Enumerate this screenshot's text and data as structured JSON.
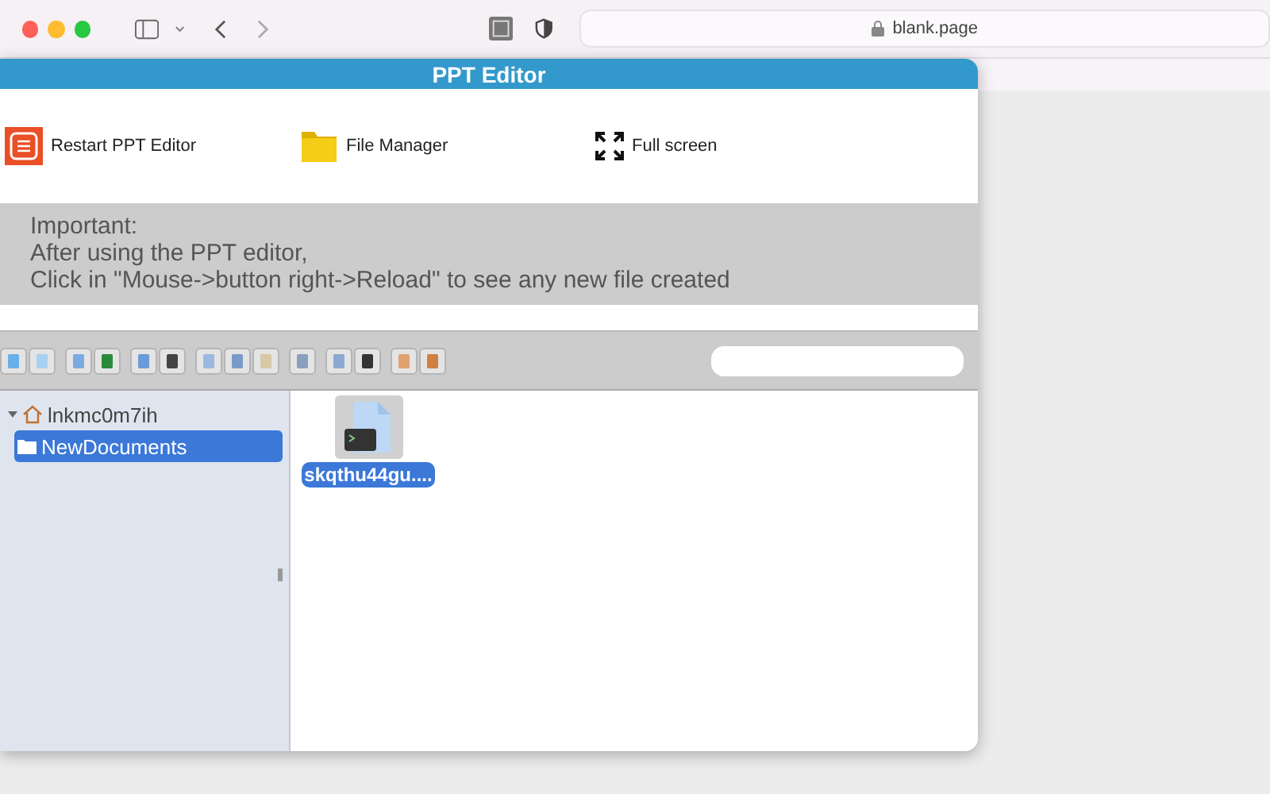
{
  "browser": {
    "address": "blank.page"
  },
  "window": {
    "title": "PPT Editor"
  },
  "actions": [
    {
      "kind": "restart",
      "label": "Restart PPT Editor"
    },
    {
      "kind": "folder",
      "label": "File Manager"
    },
    {
      "kind": "fullscreen",
      "label": "Full screen"
    }
  ],
  "notice": [
    "Important:",
    "After using the PPT editor,",
    "Click in \"Mouse->button right->Reload\" to see any new file created"
  ],
  "tree": [
    {
      "label": "lnkmc0m7ih",
      "expanded": true,
      "selected": false,
      "children": [
        {
          "label": "NewDocuments",
          "selected": true
        }
      ]
    }
  ],
  "files": [
    {
      "name": "skqthu44gu....",
      "selected": true
    }
  ]
}
